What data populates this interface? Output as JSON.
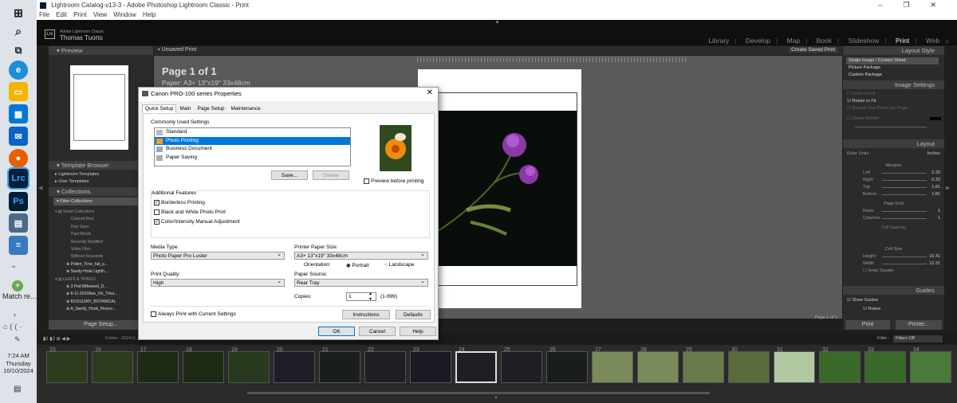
{
  "window": {
    "title": "Lightroom Catalog-v13-3 - Adobe Photoshop Lightroom Classic - Print"
  },
  "menu": [
    "File",
    "Edit",
    "Print",
    "View",
    "Window",
    "Help"
  ],
  "identity": {
    "sub": "Adobe Lightroom Classic",
    "user": "Thomas Tuorto",
    "logo": "Lrc"
  },
  "modules": [
    "Library",
    "Develop",
    "Map",
    "Book",
    "Slideshow",
    "Print",
    "Web"
  ],
  "left": {
    "preview": "Preview",
    "template_browser": "Template Browser",
    "templates": [
      "Lightroom Templates",
      "User Templates"
    ],
    "collections": "Collections",
    "filter": "Filter Collections",
    "smart": "Smart Collections",
    "smart_items": [
      "Colored Red",
      "Five Stars",
      "Past Month",
      "Recently Modified",
      "Video Files",
      "Without Keywords"
    ],
    "items": [
      "Pollen_Time_full_p...",
      "Sandy Hook Lighth..."
    ],
    "group2": "LEAFS & THINGS",
    "items2": [
      "3 Pod Milkweed_D...",
      "8-11-2021Bee_On_Thist...",
      "8103110NY_BOTANICAL",
      "A_Sandy_Hook_Pineco..."
    ],
    "page_setup": "Page Setup..."
  },
  "center": {
    "unsaved": "Unsaved Print",
    "create": "Create Saved Print",
    "page": "Page 1 of 1",
    "paper": "Paper:  A3+ 13\"x19\" 33x48cm",
    "page_footer": "Page 1 of 1"
  },
  "right": {
    "layout_style": "Layout Style",
    "styles": [
      "Single Image / Contact Sheet",
      "Picture Package",
      "Custom Package"
    ],
    "image_settings": "Image Settings",
    "img_opts": [
      "Zoom to Fill",
      "Rotate to Fit",
      "Repeat One Photo per Page",
      "Stroke Border"
    ],
    "layout": "Layout",
    "ruler_units": "Ruler Units :",
    "ruler_val": "Inches",
    "margins": "Margins",
    "margin_rows": [
      {
        "l": "Left",
        "v": "0.33"
      },
      {
        "l": "Right",
        "v": "0.33"
      },
      {
        "l": "Top",
        "v": "1.81"
      },
      {
        "l": "Bottom",
        "v": "1.81"
      }
    ],
    "page_grid": "Page Grid",
    "grid_rows": [
      {
        "l": "Rows",
        "v": "1"
      },
      {
        "l": "Columns",
        "v": "1"
      }
    ],
    "cell_spacing": "Cell Spacing",
    "cell_size": "Cell Size",
    "size_rows": [
      {
        "l": "Height",
        "v": "15.41"
      },
      {
        "l": "Width",
        "v": "12.31"
      }
    ],
    "keep_square": "Keep Square",
    "guides": "Guides",
    "show_guides": "Show Guides",
    "rulers": "Rulers",
    "print": "Print",
    "printer": "Printer..."
  },
  "filmstrip": {
    "folder": "Folder : 2024-0...",
    "filter": "Filter :",
    "filter_val": "Filters Off",
    "numbers": [
      "15",
      "16",
      "17",
      "18",
      "19",
      "20",
      "21",
      "22",
      "23",
      "24",
      "25",
      "26",
      "27",
      "28",
      "29",
      "30",
      "31",
      "32",
      "33",
      "34"
    ]
  },
  "dialog": {
    "title": "Canon PRO-100 series Properties",
    "tabs": [
      "Quick Setup",
      "Main",
      "Page Setup",
      "Maintenance"
    ],
    "common": "Commonly Used Settings",
    "settings": [
      "Standard",
      "Photo Printing",
      "Business Document",
      "Paper Saving"
    ],
    "save": "Save...",
    "delete": "Delete",
    "preview_before": "Preview before printing",
    "additional": "Additional Features",
    "features": [
      "Borderless Printing",
      "Black and White Photo Print",
      "Color/Intensity Manual Adjustment"
    ],
    "media_label": "Media Type:",
    "media": "Photo Paper Pro Luster",
    "paper_size_label": "Printer Paper Size:",
    "paper_size": "A3+ 13\"x19\" 33x48cm",
    "orientation": "Orientation:",
    "portrait": "Portrait",
    "landscape": "Landscape",
    "quality_label": "Print Quality:",
    "quality": "High",
    "source_label": "Paper Source:",
    "source": "Rear Tray",
    "copies_label": "Copies:",
    "copies": "1",
    "copies_range": "(1-999)",
    "always": "Always Print with Current Settings",
    "instructions": "Instructions",
    "defaults": "Defaults",
    "ok": "OK",
    "cancel": "Cancel",
    "help": "Help"
  },
  "taskbar": {
    "match": "Match re...",
    "time": "7:24 AM",
    "day": "Thursday",
    "date": "10/10/2024"
  }
}
